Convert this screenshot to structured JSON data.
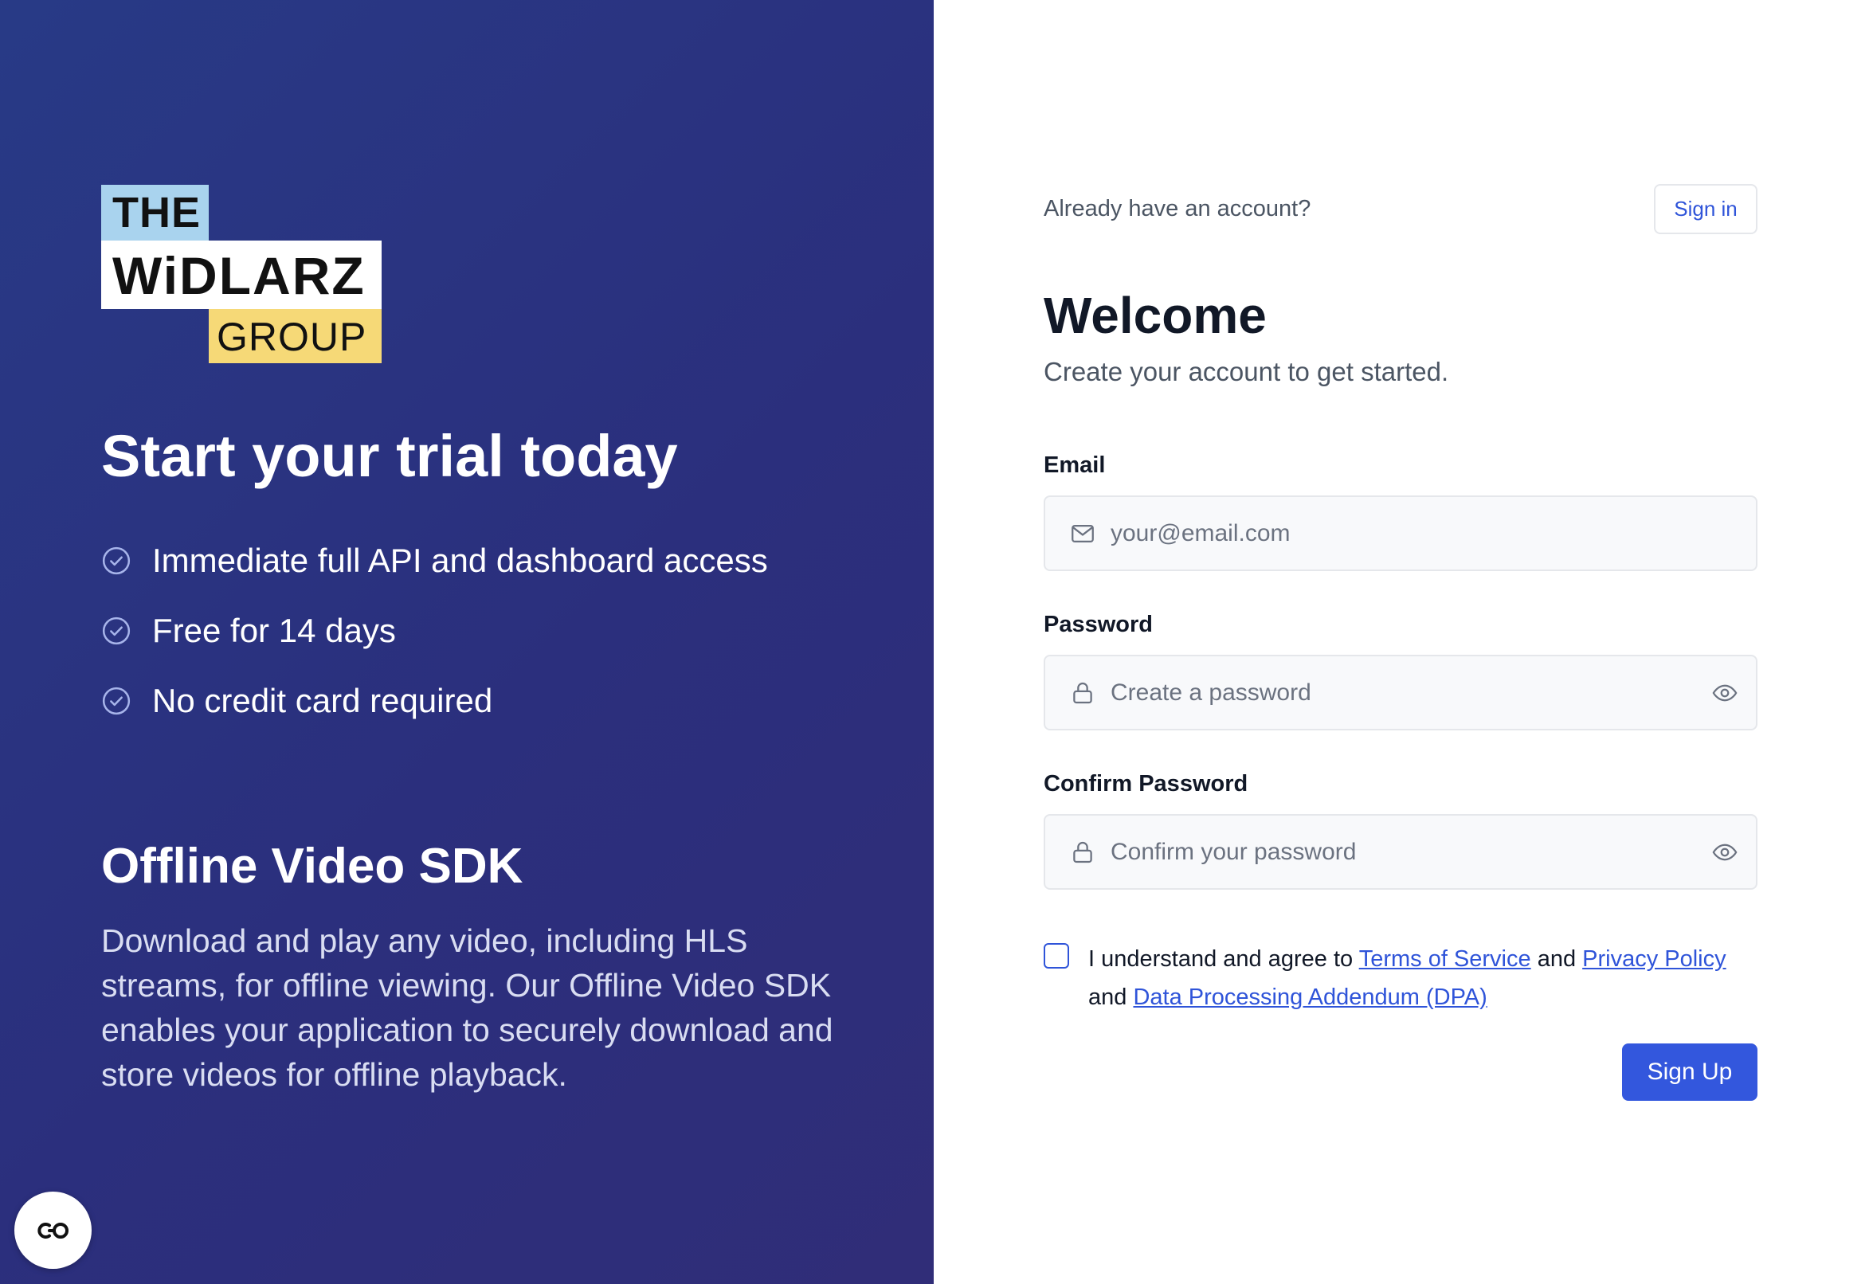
{
  "brand": {
    "logo_the": "THE",
    "logo_widlarz": "WiDLARZ",
    "logo_group": "GROUP",
    "colors": {
      "the_bg": "#a9d3ee",
      "group_bg": "#f6d977",
      "panel": "#2b307d"
    }
  },
  "promo": {
    "title": "Start your trial today",
    "features": [
      {
        "icon": "check-circle-icon",
        "label": "Immediate full API and dashboard access"
      },
      {
        "icon": "check-circle-icon",
        "label": "Free for 14 days"
      },
      {
        "icon": "check-circle-icon",
        "label": "No credit card required"
      }
    ],
    "product_title": "Offline Video SDK",
    "product_description": "Download and play any video, including HLS streams, for offline viewing. Our Offline Video SDK enables your application to securely download and store videos for offline playback."
  },
  "fab": {
    "icon": "co-logo-icon"
  },
  "signin_prompt": {
    "text": "Already have an account?",
    "button_label": "Sign in"
  },
  "form": {
    "title": "Welcome",
    "subtitle": "Create your account to get started.",
    "email": {
      "label": "Email",
      "placeholder": "your@email.com",
      "value": "",
      "icon": "mail-icon"
    },
    "password": {
      "label": "Password",
      "placeholder": "Create a password",
      "value": "",
      "icon": "lock-icon",
      "toggle_icon": "eye-icon"
    },
    "confirm_password": {
      "label": "Confirm Password",
      "placeholder": "Confirm your password",
      "value": "",
      "icon": "lock-icon",
      "toggle_icon": "eye-icon"
    },
    "agreement": {
      "checked": false,
      "prefix": "I understand and agree to ",
      "terms": "Terms of Service",
      "and1": " and ",
      "privacy": "Privacy Policy",
      "and2": " and ",
      "dpa": "Data Processing Addendum (DPA)"
    },
    "submit_label": "Sign Up",
    "accent_color": "#3357dd"
  }
}
